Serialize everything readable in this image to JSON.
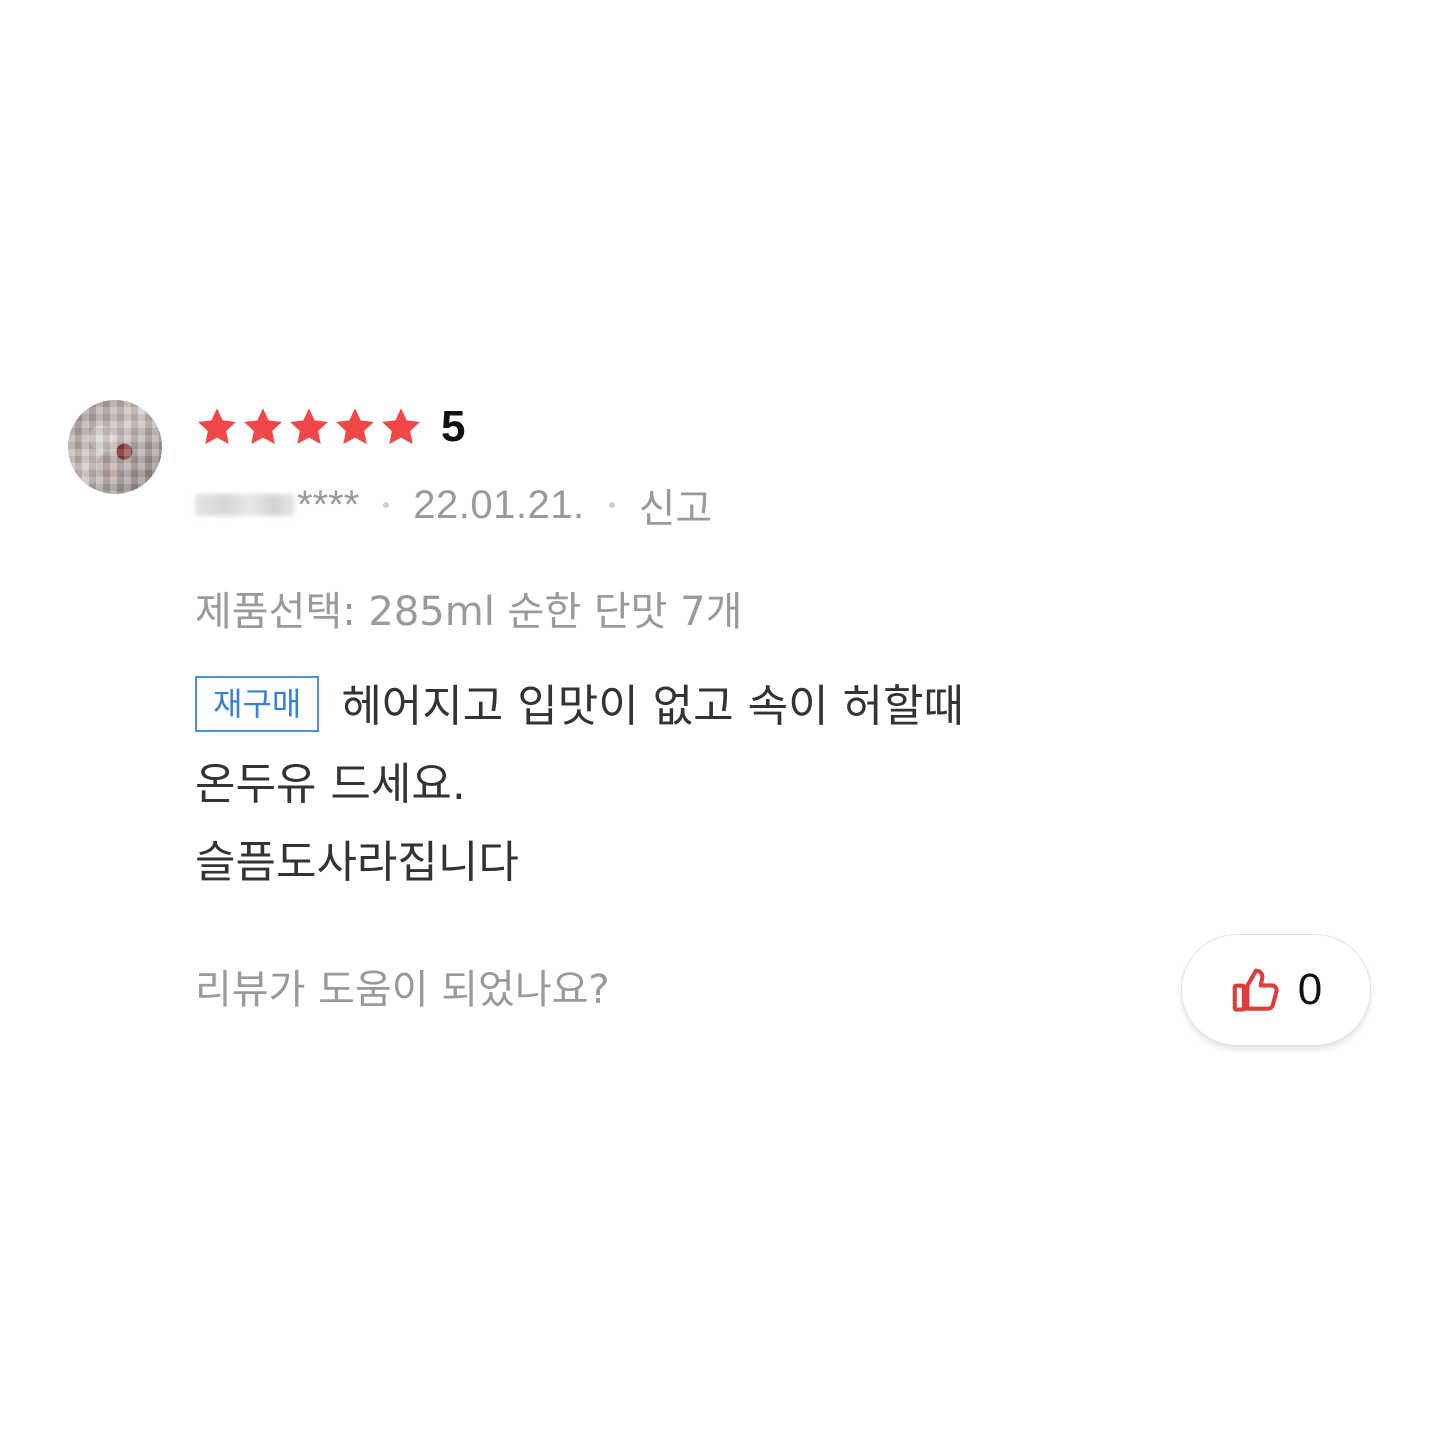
{
  "review": {
    "rating": {
      "stars_filled": 5,
      "stars_total": 5,
      "value": "5",
      "star_color": "#f04848"
    },
    "author": {
      "masked_suffix": "****"
    },
    "date": "22.01.21.",
    "report_label": "신고",
    "option_text": "제품선택: 285ml 순한 단맛 7개",
    "tag_label": "재구매",
    "tag_color": "#3b7fd0",
    "body_lines": [
      "헤어지고 입맛이 없고 속이 허할때",
      "온두유 드세요.",
      "슬픔도사라집니다"
    ]
  },
  "helpful": {
    "question": "리뷰가 도움이 되었나요?",
    "like_count": "0",
    "icon": "thumbs-up-icon",
    "icon_color": "#e03c3c"
  }
}
